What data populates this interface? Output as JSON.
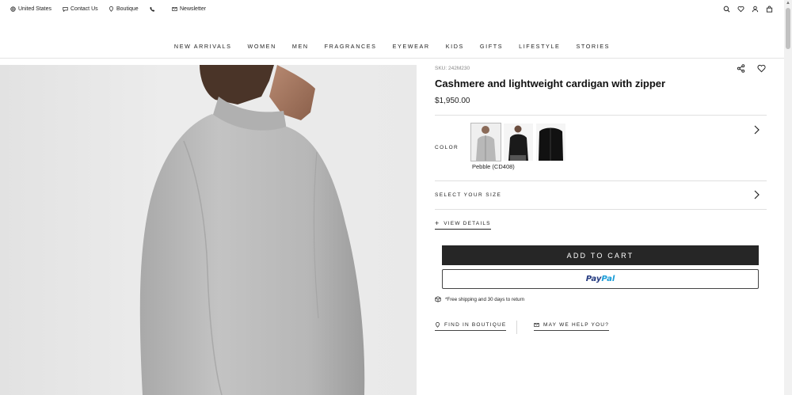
{
  "utility": {
    "country": "United States",
    "contact": "Contact Us",
    "boutique": "Boutique",
    "newsletter": "Newsletter",
    "icons": [
      "globe-icon",
      "chat-icon",
      "pin-icon",
      "phone-icon",
      "mail-icon",
      "search-icon",
      "heart-icon",
      "user-icon",
      "bag-icon"
    ]
  },
  "nav": {
    "items": [
      "NEW ARRIVALS",
      "WOMEN",
      "MEN",
      "FRAGRANCES",
      "EYEWEAR",
      "KIDS",
      "GIFTS",
      "LIFESTYLE",
      "STORIES"
    ]
  },
  "product": {
    "sku": "SKU: 242M230",
    "title": "Cashmere and lightweight cardigan with zipper",
    "price": "$1,950.00",
    "color_label": "COLOR",
    "selected_color": "Pebble (CD408)",
    "swatch_colors": [
      "#b8b8b8",
      "#1a1a1a",
      "#111111"
    ],
    "size_label": "SELECT YOUR SIZE",
    "view_details": "VIEW DETAILS",
    "add_to_cart": "ADD TO CART",
    "paypal_part1": "Pay",
    "paypal_part2": "Pal",
    "shipping_note": "*Free shipping and 30 days to return",
    "find_boutique": "FIND IN BOUTIQUE",
    "help": "MAY WE HELP YOU?"
  },
  "colors": {
    "button_dark": "#262626",
    "paypal_blue_dark": "#253b80",
    "paypal_blue_light": "#179bd7"
  }
}
